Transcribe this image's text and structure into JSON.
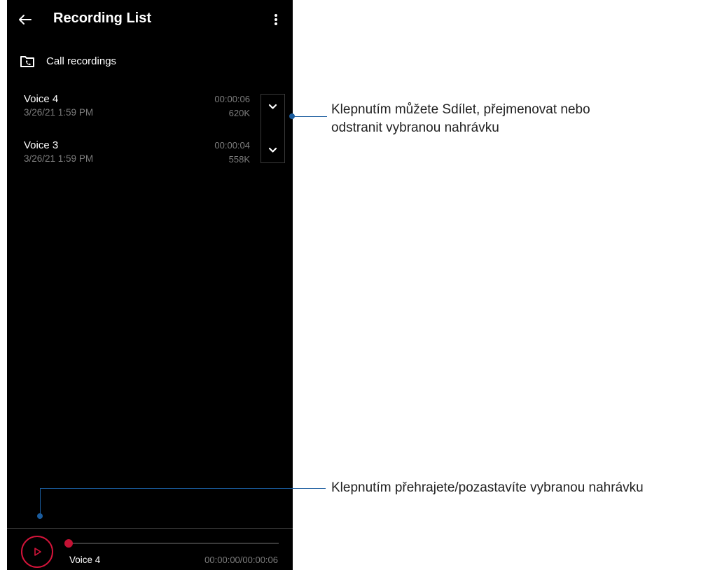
{
  "app": {
    "title": "Recording List"
  },
  "folder": {
    "label": "Call recordings",
    "icon": "call-folder-icon"
  },
  "recordings": [
    {
      "name": "Voice 4",
      "date": "3/26/21 1:59 PM",
      "duration": "00:00:06",
      "size": "620K"
    },
    {
      "name": "Voice 3",
      "date": "3/26/21 1:59 PM",
      "duration": "00:00:04",
      "size": "558K"
    }
  ],
  "player": {
    "now_playing": "Voice 4",
    "time": "00:00:00/00:00:06",
    "progress": 0
  },
  "callouts": {
    "options_line1": "Klepnutím můžete Sdílet, přejmenovat nebo",
    "options_line2": "odstranit vybranou nahrávku",
    "play": "Klepnutím přehrajete/pozastavíte vybranou nahrávku"
  },
  "colors": {
    "background": "#000000",
    "accent": "#d4143a",
    "secondary_text": "#7d7d7d",
    "callout": "#1a5c9e"
  }
}
